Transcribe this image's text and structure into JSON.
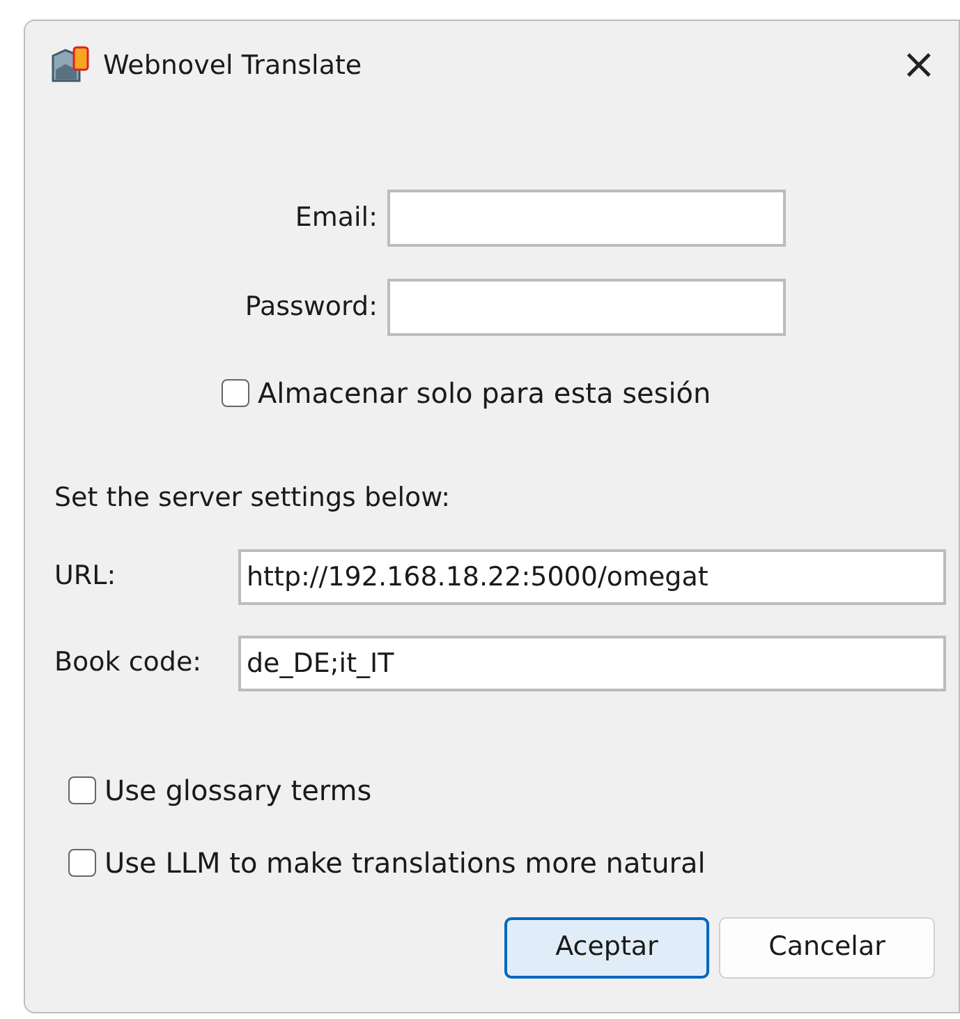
{
  "window": {
    "title": "Webnovel Translate",
    "close": "×"
  },
  "login": [
    {
      "label": "Email:"
    },
    {
      "label": "Password:"
    }
  ],
  "session_checkbox": {
    "label": "Almacenar solo para esta sesión",
    "checked": false
  },
  "server_heading": "Set the server settings below:",
  "server": [
    {
      "label": "URL:",
      "value": "http://192.168.18.22:5000/omegat"
    },
    {
      "label": "Book code:",
      "value": "de_DE;it_IT"
    }
  ],
  "options": [
    {
      "label": "Use glossary terms",
      "checked": false
    },
    {
      "label": "Use LLM to make translations more natural",
      "checked": false
    }
  ],
  "buttons": [
    {
      "label": "Aceptar",
      "default": true
    },
    {
      "label": "Cancelar",
      "default": false
    }
  ]
}
